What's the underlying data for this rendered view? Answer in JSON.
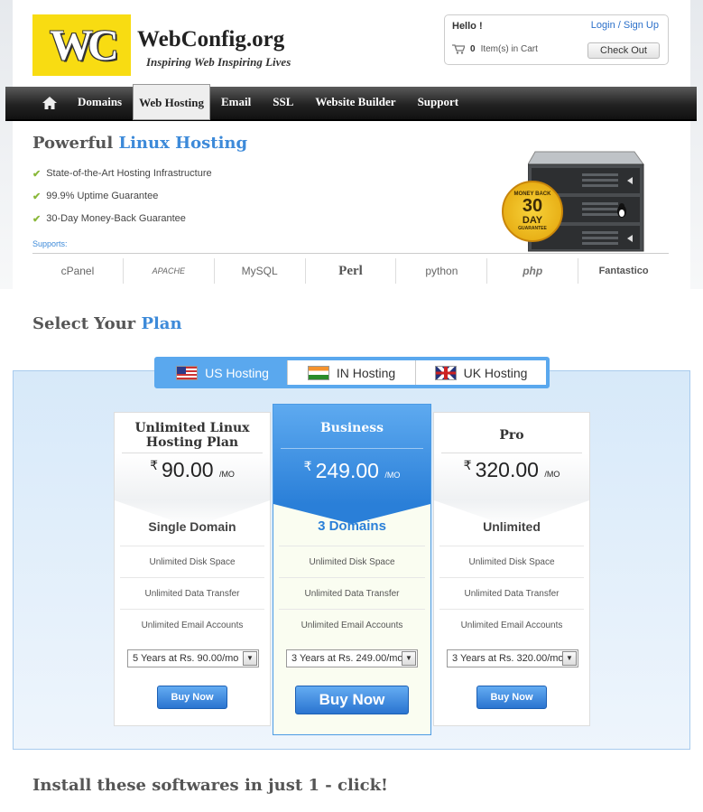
{
  "header": {
    "logo_text": "WC",
    "brand": "WebConfig.org",
    "tagline": "Inspiring Web Inspiring Lives"
  },
  "account": {
    "hello": "Hello !",
    "login_signup": "Login / Sign Up",
    "cart_count": "0",
    "cart_text": "Item(s) in Cart",
    "checkout": "Check Out"
  },
  "nav": {
    "items": [
      "Domains",
      "Web Hosting",
      "Email",
      "SSL",
      "Website Builder",
      "Support"
    ],
    "active": "Web Hosting"
  },
  "hero": {
    "title_plain": "Powerful",
    "title_highlight": "Linux Hosting",
    "features": [
      "State-of-the-Art Hosting Infrastructure",
      "99.9% Uptime Guarantee",
      "30-Day Money-Back Guarantee"
    ],
    "supports_label": "Supports:",
    "supports": [
      "cPanel",
      "APACHE",
      "MySQL",
      "Perl",
      "python",
      "php",
      "Fantastico"
    ],
    "badge_top": "MONEY BACK",
    "badge_num": "30",
    "badge_day": "DAY",
    "badge_bottom": "GUARANTEE"
  },
  "plans_section": {
    "title_plain": "Select Your",
    "title_highlight": "Plan",
    "tabs": [
      "US Hosting",
      "IN Hosting",
      "UK Hosting"
    ],
    "active_tab": "US Hosting"
  },
  "plans": [
    {
      "name": "Unlimited Linux Hosting Plan",
      "currency": "₹",
      "price": "90.00",
      "per": "/MO",
      "domains": "Single Domain",
      "features": [
        "Unlimited Disk Space",
        "Unlimited Data Transfer",
        "Unlimited Email Accounts"
      ],
      "term": "5 Years at Rs. 90.00/mo",
      "buy": "Buy Now"
    },
    {
      "name": "Business",
      "currency": "₹",
      "price": "249.00",
      "per": "/MO",
      "domains": "3 Domains",
      "features": [
        "Unlimited Disk Space",
        "Unlimited Data Transfer",
        "Unlimited Email Accounts"
      ],
      "term": "3 Years at Rs. 249.00/mo",
      "buy": "Buy Now"
    },
    {
      "name": "Pro",
      "currency": "₹",
      "price": "320.00",
      "per": "/MO",
      "domains": "Unlimited",
      "features": [
        "Unlimited Disk Space",
        "Unlimited Data Transfer",
        "Unlimited Email Accounts"
      ],
      "term": "3 Years at Rs. 320.00/mo",
      "buy": "Buy Now"
    }
  ],
  "install": {
    "title": "Install these softwares in just 1 - click!"
  },
  "colors": {
    "accent": "#3d8ad9",
    "nav_dark": "#222222",
    "logo_yellow": "#f8dc12",
    "check_green": "#8ab83a"
  }
}
